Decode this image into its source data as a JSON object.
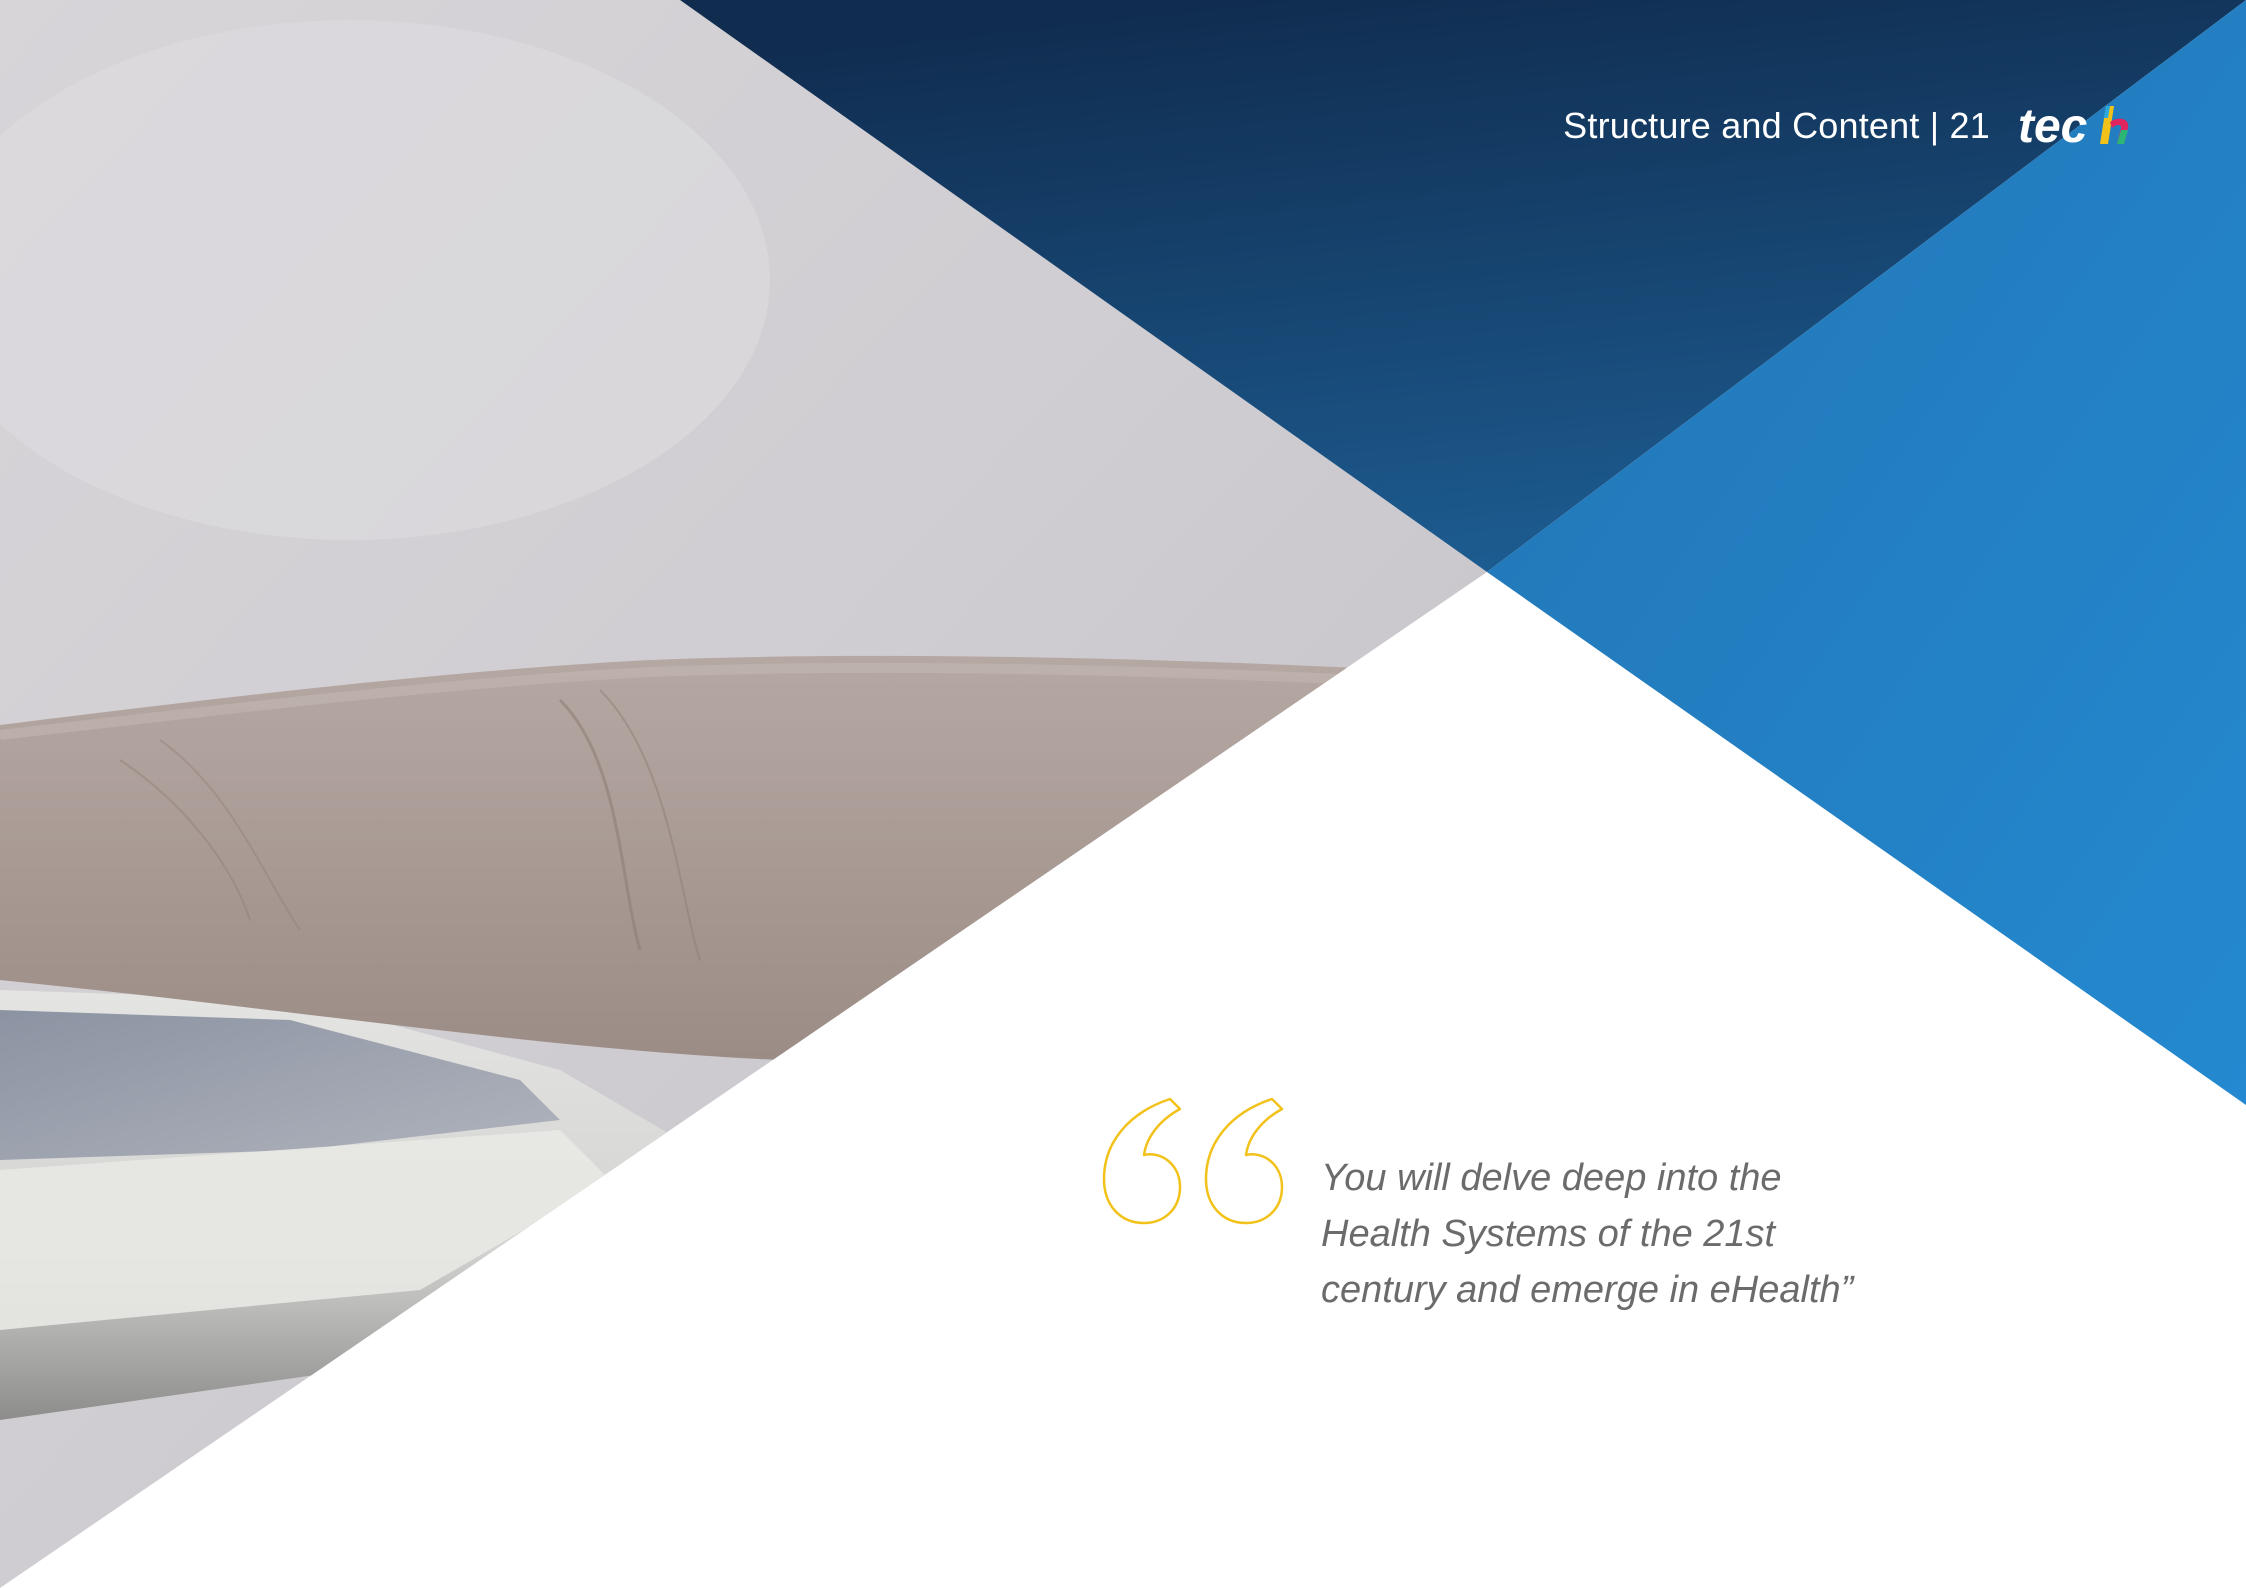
{
  "header": {
    "section_title": "Structure and Content",
    "separator": "|",
    "page_number": "21",
    "logo_text": "tech"
  },
  "quote": {
    "lines": [
      "You will delve deep into the",
      "Health Systems of the 21st",
      "century and emerge in eHealth”"
    ]
  },
  "colors": {
    "navy": "#12365c",
    "blue": "#2383c8",
    "quote_mark": "#f2c21a",
    "quote_text": "#6b6b6b",
    "header_text": "#ffffff"
  }
}
